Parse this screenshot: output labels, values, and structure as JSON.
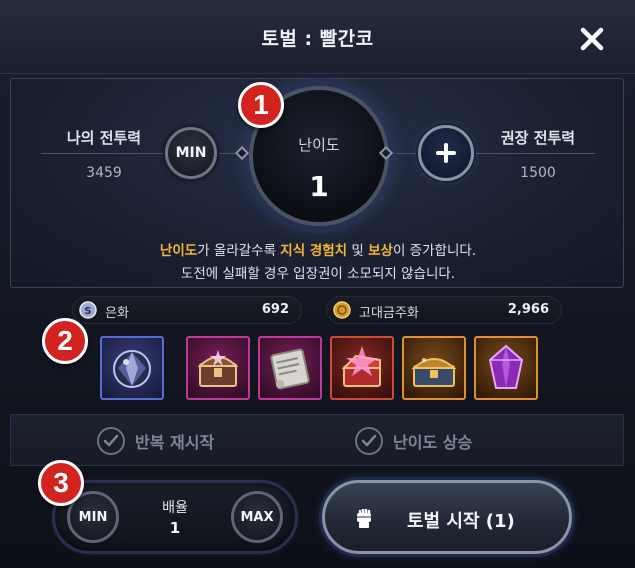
{
  "window": {
    "title": "토벌 : 빨간코"
  },
  "power": {
    "my_label": "나의 전투력",
    "my_value": "3459",
    "recommended_label": "권장 전투력",
    "recommended_value": "1500"
  },
  "difficulty": {
    "label": "난이도",
    "value": "1",
    "min_label": "MIN"
  },
  "info": {
    "line1_part1": "난이도",
    "line1_part2": "가 올라갈수록 ",
    "line1_part3": "지식 경험치",
    "line1_part4": " 및 ",
    "line1_part5": "보상",
    "line1_part6": "이 증가합니다.",
    "line2": "도전에 실패할 경우 입장권이 소모되지 않습니다."
  },
  "currencies": [
    {
      "name": "은화",
      "value": "692",
      "icon": "silver-coin-icon",
      "color": "#b6c2e8"
    },
    {
      "name": "고대금주화",
      "value": "2,966",
      "icon": "ancient-gold-coin-icon",
      "color": "#e0a63a"
    }
  ],
  "rewards": [
    {
      "icon": "crystal-orb-icon",
      "rarity_color": "#5b6bd6"
    },
    {
      "icon": "purple-treasure-chest-icon",
      "rarity_color": "#c0389a"
    },
    {
      "icon": "scroll-icon",
      "rarity_color": "#c0389a"
    },
    {
      "icon": "red-gift-chest-icon",
      "rarity_color": "#d04a36"
    },
    {
      "icon": "golden-treasure-chest-icon",
      "rarity_color": "#e0912a"
    },
    {
      "icon": "purple-gem-icon",
      "rarity_color": "#e0912a"
    }
  ],
  "toggles": {
    "repeat_label": "반복 재시작",
    "raise_label": "난이도 상승"
  },
  "multiplier": {
    "label": "배율",
    "value": "1",
    "min_label": "MIN",
    "max_label": "MAX"
  },
  "start": {
    "label": "토벌 시작 (1)"
  },
  "badges": [
    "1",
    "2",
    "3"
  ],
  "colors": {
    "accent_badge": "#d2231f",
    "highlight_text": "#f1b732"
  }
}
